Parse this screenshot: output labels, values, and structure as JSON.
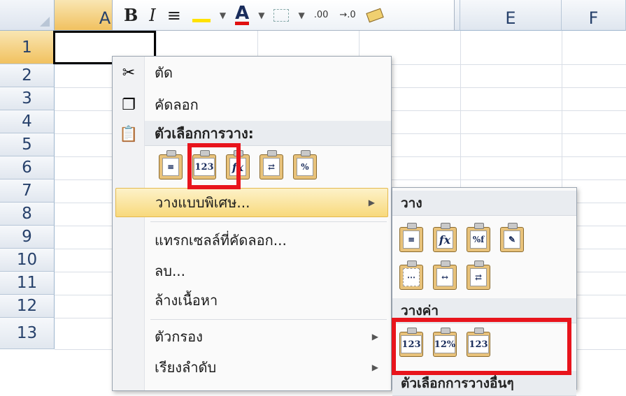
{
  "columns": [
    {
      "label": "A",
      "selected": true
    },
    {
      "label": "",
      "selected": false
    },
    {
      "label": "",
      "selected": false
    },
    {
      "label": "",
      "selected": false
    },
    {
      "label": "E",
      "selected": false
    },
    {
      "label": "F",
      "selected": false
    }
  ],
  "rows": [
    "1",
    "2",
    "3",
    "4",
    "5",
    "6",
    "7",
    "8",
    "9",
    "10",
    "11",
    "12",
    "13"
  ],
  "mini_toolbar": {
    "bold": "B",
    "italic": "I",
    "align": "≡",
    "font_color": "A",
    "inc_decimal": ".00",
    "dec_decimal": "→.0"
  },
  "context_menu": {
    "cut": "ตัด",
    "copy": "คัดลอก",
    "paste_options_header": "ตัวเลือกการวาง:",
    "paste_icons": [
      "paste",
      "123",
      "fx",
      "transpose",
      "%"
    ],
    "paste_special": "วางแบบพิเศษ...",
    "insert_copied": "แทรกเซลล์ที่คัดลอก...",
    "delete": "ลบ...",
    "clear_contents": "ล้างเนื้อหา",
    "filter": "ตัวกรอง",
    "sort": "เรียงลำดับ"
  },
  "submenu": {
    "paste_header": "วาง",
    "paste_icons_row1": [
      "paste",
      "fx",
      "%fx",
      "keep-width"
    ],
    "paste_icons_row2": [
      "no-border",
      "col-width",
      "transpose"
    ],
    "values_header": "วางค่า",
    "values_icons": [
      "123",
      "123%",
      "123 brush"
    ],
    "other_header": "ตัวเลือกการวางอื่นๆ"
  },
  "colors": {
    "highlight_red": "#e8141c",
    "menu_highlight": "#f8d97c"
  }
}
